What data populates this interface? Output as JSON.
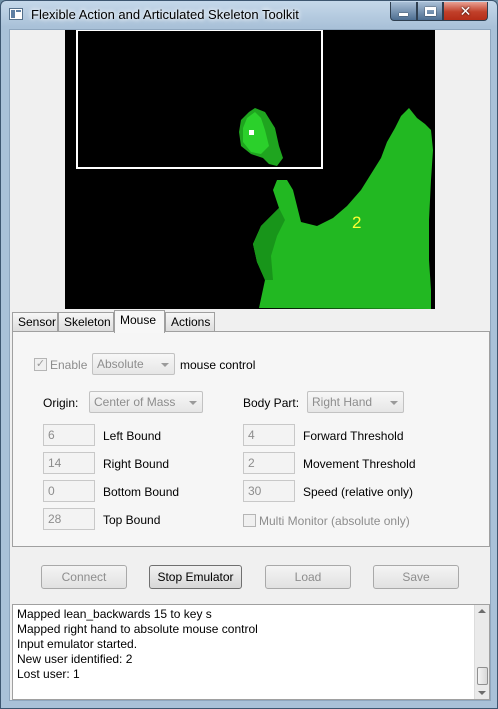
{
  "window": {
    "title": "Flexible Action and Articulated Skeleton Toolkit",
    "minimize_icon": "minimize-icon",
    "maximize_icon": "maximize-icon",
    "close_icon": "close-icon",
    "close_glyph": "✕"
  },
  "depth_view": {
    "user_id": "2",
    "background_color": "#000000",
    "user_color": "#1fbf1f",
    "box_color": "#ffffff"
  },
  "tabs": [
    {
      "label": "Sensor",
      "active": false
    },
    {
      "label": "Skeleton",
      "active": false
    },
    {
      "label": "Mouse",
      "active": true
    },
    {
      "label": "Actions",
      "active": false
    }
  ],
  "mouse": {
    "enable_label": "Enable",
    "enable_checked": true,
    "mode": "Absolute",
    "mouse_control_label": "mouse control",
    "origin_label": "Origin:",
    "origin_value": "Center of Mass",
    "body_part_label": "Body Part:",
    "body_part_value": "Right Hand",
    "left_bound": {
      "value": "6",
      "label": "Left Bound"
    },
    "right_bound": {
      "value": "14",
      "label": "Right Bound"
    },
    "bottom_bound": {
      "value": "0",
      "label": "Bottom Bound"
    },
    "top_bound": {
      "value": "28",
      "label": "Top Bound"
    },
    "forward_threshold": {
      "value": "4",
      "label": "Forward Threshold"
    },
    "movement_threshold": {
      "value": "2",
      "label": "Movement Threshold"
    },
    "speed": {
      "value": "30",
      "label": "Speed (relative only)"
    },
    "multi_monitor": {
      "label": "Multi Monitor (absolute only)",
      "checked": false
    }
  },
  "buttons": {
    "connect": "Connect",
    "stop_emulator": "Stop Emulator",
    "load": "Load",
    "save": "Save"
  },
  "log": [
    "Mapped lean_backwards 15 to key s",
    "Mapped right hand to absolute mouse control",
    "Input emulator started.",
    "New user identified: 2",
    "Lost user: 1"
  ]
}
